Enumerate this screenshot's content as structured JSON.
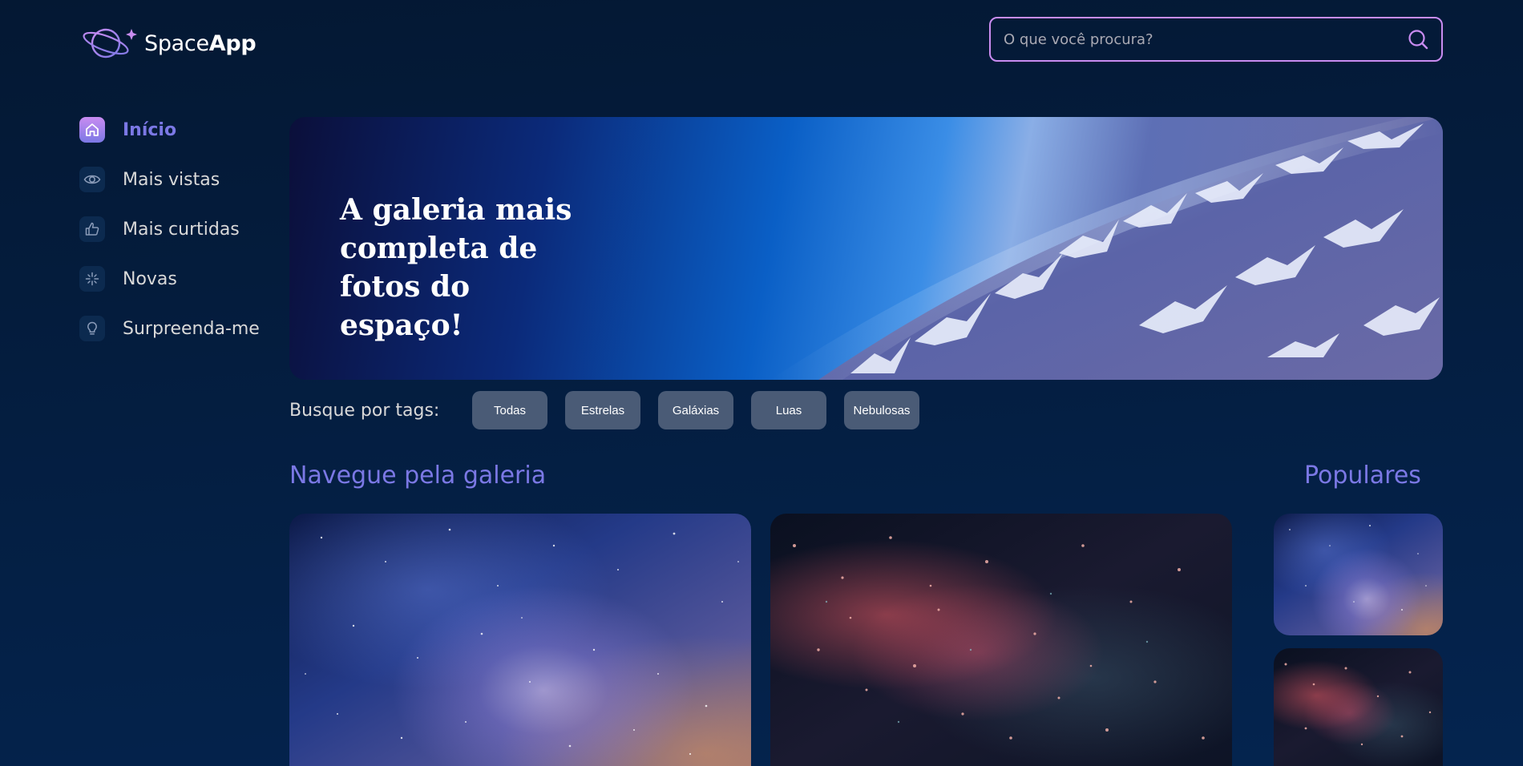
{
  "brand": {
    "name_light": "Space",
    "name_bold": "App"
  },
  "search": {
    "placeholder": "O que você procura?",
    "value": ""
  },
  "sidebar": {
    "items": [
      {
        "label": "Início",
        "icon": "home-icon",
        "active": true
      },
      {
        "label": "Mais vistas",
        "icon": "eye-icon",
        "active": false
      },
      {
        "label": "Mais curtidas",
        "icon": "thumbs-up-icon",
        "active": false
      },
      {
        "label": "Novas",
        "icon": "sparkle-icon",
        "active": false
      },
      {
        "label": "Surpreenda-me",
        "icon": "lightbulb-icon",
        "active": false
      }
    ]
  },
  "banner": {
    "title": "A galeria mais completa de fotos do espaço!"
  },
  "tags": {
    "label": "Busque por tags:",
    "items": [
      "Todas",
      "Estrelas",
      "Galáxias",
      "Luas",
      "Nebulosas"
    ]
  },
  "gallery": {
    "title": "Navegue pela galeria"
  },
  "popular": {
    "title": "Populares"
  },
  "colors": {
    "accent": "#7B78E5",
    "accent_light": "#C98CF1",
    "background": "#041833",
    "tag_bg": "#4A5B76"
  }
}
